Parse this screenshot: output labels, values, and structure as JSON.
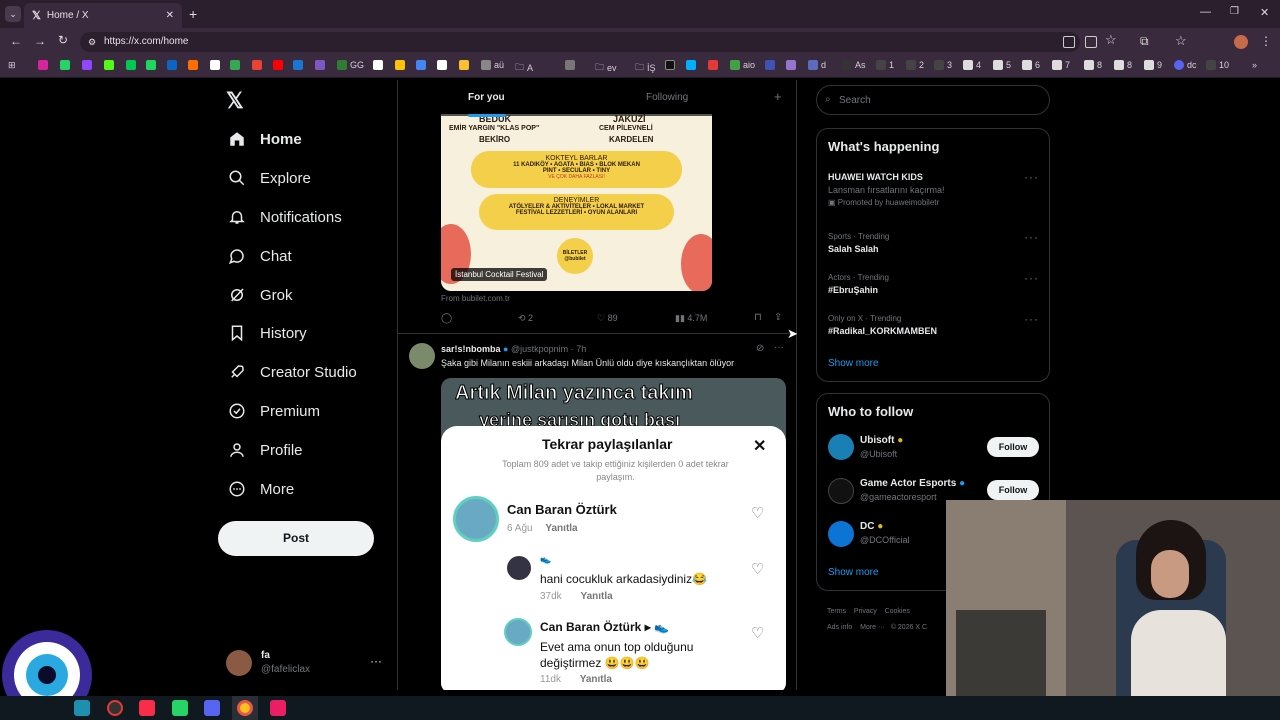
{
  "browser": {
    "tab_title": "Home / X",
    "url": "https://x.com/home",
    "bookmarks": [
      "GG",
      "aü",
      "A",
      "ev",
      "İŞ",
      "aio",
      "d",
      "As",
      "1",
      "2",
      "3",
      "4",
      "5",
      "6",
      "7",
      "8",
      "8",
      "9",
      "dc",
      "10"
    ]
  },
  "nav": {
    "items": [
      "Home",
      "Explore",
      "Notifications",
      "Chat",
      "Grok",
      "History",
      "Creator Studio",
      "Premium",
      "Profile",
      "More"
    ],
    "post_label": "Post",
    "account_name": "fa",
    "account_handle": "@fafeliclax"
  },
  "timeline": {
    "tabs": [
      "For you",
      "Following"
    ],
    "card_top": {
      "lines": [
        "BEDÜK",
        "EMİR YARGIN \"KLAS POP\"",
        "BEKİRO",
        "JAKUZİ",
        "CEM PİLEVNELİ",
        "KARDELEN",
        "KOKTEYL BARLAR",
        "11 KADIKÖY • AGATA • BIAS • BLOK MEKAN",
        "PINT • SECULAR • TINY",
        "VE ÇOK DAHA FAZLASI!",
        "DENEYİMLER",
        "ATÖLYELER & AKTİVİTELER • LOKAL MARKET",
        "FESTİVAL LEZZETLERİ • OYUN ALANLARI",
        "BİLETLER @bubilet"
      ],
      "caption": "İstanbul Cocktail Festival",
      "source": "From bubilet.com.tr",
      "retweets": "2",
      "likes": "89",
      "views": "4.7M"
    },
    "post": {
      "author": "sar!s!nbomba",
      "handle": "@justkpopnim",
      "time": "7h",
      "text": "Şaka gibi Milanın eskiii arkadaşı Milan Ünlü oldu diye kıskançlıktan ölüyor",
      "video_caption_1": "Artık Milan yazınca takım",
      "video_caption_2": "yerine sarışın gotu başı"
    },
    "sheet": {
      "title": "Tekrar paylaşılanlar",
      "subtitle": "Toplam 809 adet ve takip ettiğiniz kişilerden 0 adet tekrar paylaşım.",
      "comments": [
        {
          "name": "Can Baran Öztürk",
          "meta": "6 Ağu",
          "reply": "Yanıtla",
          "text": ""
        },
        {
          "name": "",
          "meta": "37dk",
          "reply": "Yanıtla",
          "text": "hani cocukluk arkadasiydiniz😂"
        },
        {
          "name": "Can Baran Öztürk",
          "meta": "11dk",
          "reply": "Yanıtla",
          "text": "Evet ama onun top olduğunu değiştirmez 😃😃😃"
        }
      ]
    }
  },
  "sidebar": {
    "search_placeholder": "Search",
    "happening_title": "What's happening",
    "trends": [
      {
        "meta": "",
        "title": "HUAWEI WATCH KIDS",
        "sub": "Lansman fırsatlarını kaçırma!",
        "promo": "Promoted by huaweimobiletr"
      },
      {
        "meta": "Sports · Trending",
        "title": "Salah Salah"
      },
      {
        "meta": "Actors · Trending",
        "title": "#EbruŞahin"
      },
      {
        "meta": "Only on X · Trending",
        "title": "#Radikal_KORKMAMBEN"
      }
    ],
    "show_more": "Show more",
    "follow_title": "Who to follow",
    "follows": [
      {
        "name": "Ubisoft",
        "handle": "@Ubisoft",
        "button": "Follow"
      },
      {
        "name": "Game Actor Esports",
        "handle": "@gameactoresport",
        "button": "Follow"
      },
      {
        "name": "DC",
        "handle": "@DCOfficial",
        "button": ""
      }
    ],
    "footer": [
      "Terms",
      "Privacy",
      "Cookies",
      "Ads info",
      "More ···",
      "© 2026 X C"
    ]
  },
  "colors": {
    "accent": "#1d9bf0",
    "background": "#000000",
    "border": "#2f3336"
  }
}
